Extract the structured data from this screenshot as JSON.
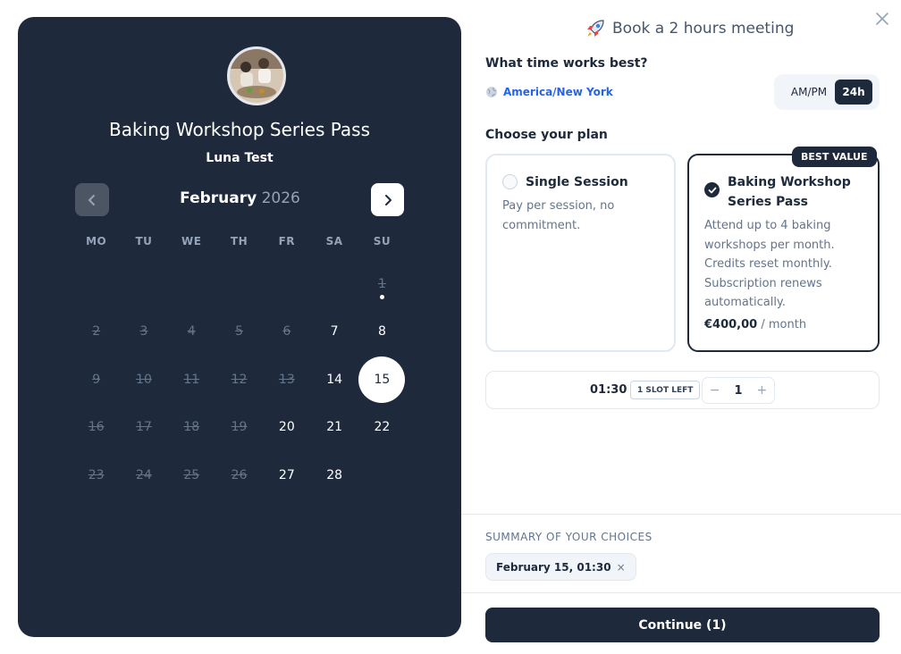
{
  "event": {
    "title": "Baking Workshop Series Pass",
    "host": "Luna Test"
  },
  "calendar": {
    "month": "February",
    "year": "2026",
    "weekdays": [
      "MO",
      "TU",
      "WE",
      "TH",
      "FR",
      "SA",
      "SU"
    ],
    "leading_blanks": 6,
    "days": [
      {
        "n": "1",
        "state": "off",
        "dot": true
      },
      {
        "n": "2",
        "state": "off"
      },
      {
        "n": "3",
        "state": "off"
      },
      {
        "n": "4",
        "state": "off"
      },
      {
        "n": "5",
        "state": "off"
      },
      {
        "n": "6",
        "state": "off"
      },
      {
        "n": "7",
        "state": "on"
      },
      {
        "n": "8",
        "state": "on"
      },
      {
        "n": "9",
        "state": "off"
      },
      {
        "n": "10",
        "state": "off"
      },
      {
        "n": "11",
        "state": "off"
      },
      {
        "n": "12",
        "state": "off"
      },
      {
        "n": "13",
        "state": "off"
      },
      {
        "n": "14",
        "state": "on"
      },
      {
        "n": "15",
        "state": "selected"
      },
      {
        "n": "16",
        "state": "off"
      },
      {
        "n": "17",
        "state": "off"
      },
      {
        "n": "18",
        "state": "off"
      },
      {
        "n": "19",
        "state": "off"
      },
      {
        "n": "20",
        "state": "on"
      },
      {
        "n": "21",
        "state": "on"
      },
      {
        "n": "22",
        "state": "on"
      },
      {
        "n": "23",
        "state": "off"
      },
      {
        "n": "24",
        "state": "off"
      },
      {
        "n": "25",
        "state": "off"
      },
      {
        "n": "26",
        "state": "off"
      },
      {
        "n": "27",
        "state": "on"
      },
      {
        "n": "28",
        "state": "on"
      }
    ]
  },
  "header": {
    "title": "Book a 2 hours meeting",
    "icon": "rocket-icon"
  },
  "time": {
    "question": "What time works best?",
    "timezone": "America/New York",
    "format_ampm": "AM/PM",
    "format_24h": "24h",
    "selected_format": "24h"
  },
  "plans": {
    "question": "Choose your plan",
    "best_badge": "BEST VALUE",
    "single": {
      "name": "Single Session",
      "desc": "Pay per session, no commitment."
    },
    "pass": {
      "name": "Baking Workshop Series Pass",
      "desc": "Attend up to 4 baking workshops per month. Credits reset monthly. Subscription renews automatically.",
      "price": "€400,00",
      "period": "/ month"
    }
  },
  "slot": {
    "time": "01:30",
    "availability": "1 SLOT LEFT",
    "minus": "−",
    "quantity": "1",
    "plus": "+"
  },
  "summary": {
    "label": "SUMMARY OF YOUR CHOICES",
    "chip": "February 15, 01:30",
    "chip_remove": "×"
  },
  "actions": {
    "continue": "Continue (1)"
  },
  "colors": {
    "panel": "#1e293b",
    "accent_link": "#2563eb",
    "muted": "#64748b"
  }
}
